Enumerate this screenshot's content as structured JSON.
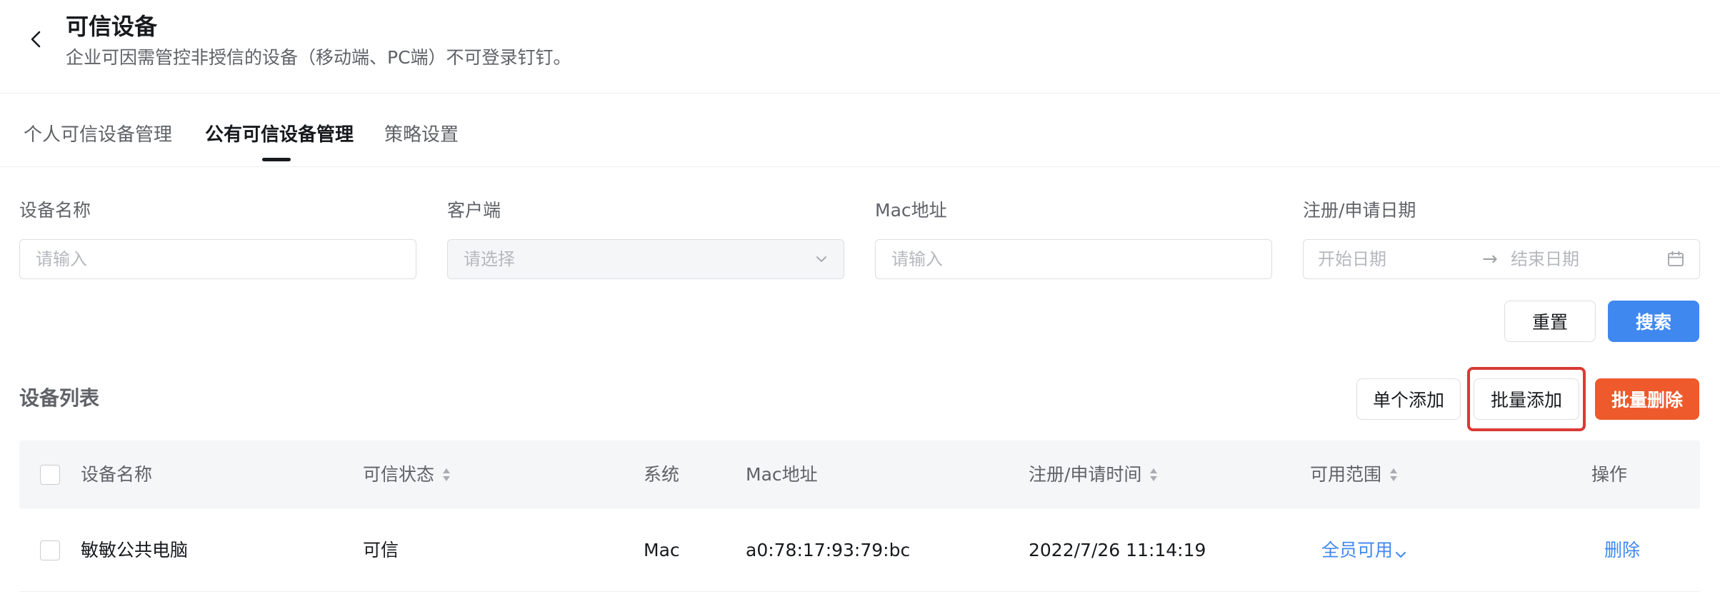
{
  "header": {
    "title": "可信设备",
    "description": "企业可因需管控非授信的设备（移动端、PC端）不可登录钉钉。"
  },
  "tabs": [
    {
      "label": "个人可信设备管理",
      "active": false
    },
    {
      "label": "公有可信设备管理",
      "active": true
    },
    {
      "label": "策略设置",
      "active": false
    }
  ],
  "filters": {
    "device_name": {
      "label": "设备名称",
      "placeholder": "请输入"
    },
    "client": {
      "label": "客户端",
      "placeholder": "请选择"
    },
    "mac": {
      "label": "Mac地址",
      "placeholder": "请输入"
    },
    "date": {
      "label": "注册/申请日期",
      "start_placeholder": "开始日期",
      "end_placeholder": "结束日期",
      "separator": "→"
    }
  },
  "form_actions": {
    "reset": "重置",
    "search": "搜索"
  },
  "list": {
    "title": "设备列表",
    "add_single": "单个添加",
    "add_batch": "批量添加",
    "delete_batch": "批量删除"
  },
  "table": {
    "columns": {
      "name": "设备名称",
      "status": "可信状态",
      "system": "系统",
      "mac": "Mac地址",
      "time": "注册/申请时间",
      "scope": "可用范围",
      "action": "操作"
    },
    "rows": [
      {
        "name": "敏敏公共电脑",
        "status": "可信",
        "system": "Mac",
        "mac": "a0:78:17:93:79:bc",
        "time": "2022/7/26 11:14:19",
        "scope": "全员可用",
        "action": "删除"
      }
    ]
  },
  "colors": {
    "primary": "#3f88f0",
    "danger": "#ee5a2c",
    "highlight": "#d93a34"
  }
}
